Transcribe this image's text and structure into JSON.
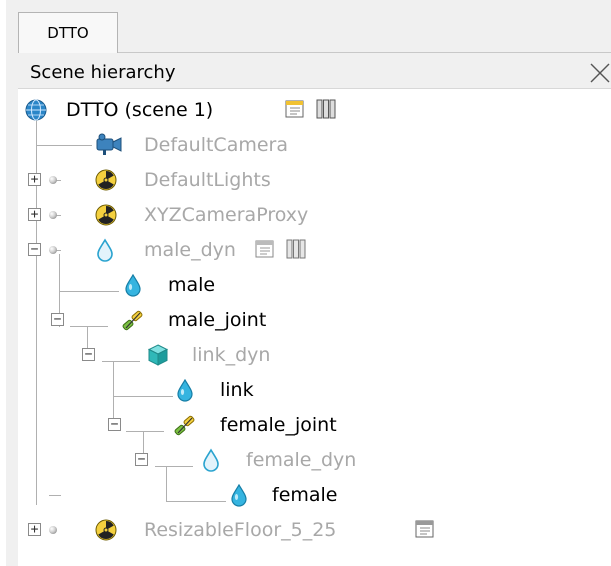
{
  "tab": {
    "label": "DTTO"
  },
  "panel": {
    "title": "Scene hierarchy",
    "close_glyph": "✕"
  },
  "tree": {
    "root": "DTTO (scene 1)",
    "default_camera": "DefaultCamera",
    "default_lights": "DefaultLights",
    "xyz_camera_proxy": "XYZCameraProxy",
    "male_dyn": "male_dyn",
    "male": "male",
    "male_joint": "male_joint",
    "link_dyn": "link_dyn",
    "link": "link",
    "female_joint": "female_joint",
    "female_dyn": "female_dyn",
    "female": "female",
    "floor": "ResizableFloor_5_25"
  },
  "expander": {
    "collapsed": "+",
    "expanded": "−"
  },
  "colors": {
    "inactive_text": "#a8a8a8",
    "tree_lines": "#b0b0b0",
    "tree_bg": "#ffffff",
    "panel_bg": "#f0f0f0"
  },
  "icons": {
    "scene": "globe-icon",
    "camera": "camera-icon",
    "lights": "radiation-icon",
    "shape": "drop-icon",
    "joint": "joint-icon",
    "dynamic": "cube-icon",
    "script": "script-icon",
    "data": "data-icon"
  }
}
